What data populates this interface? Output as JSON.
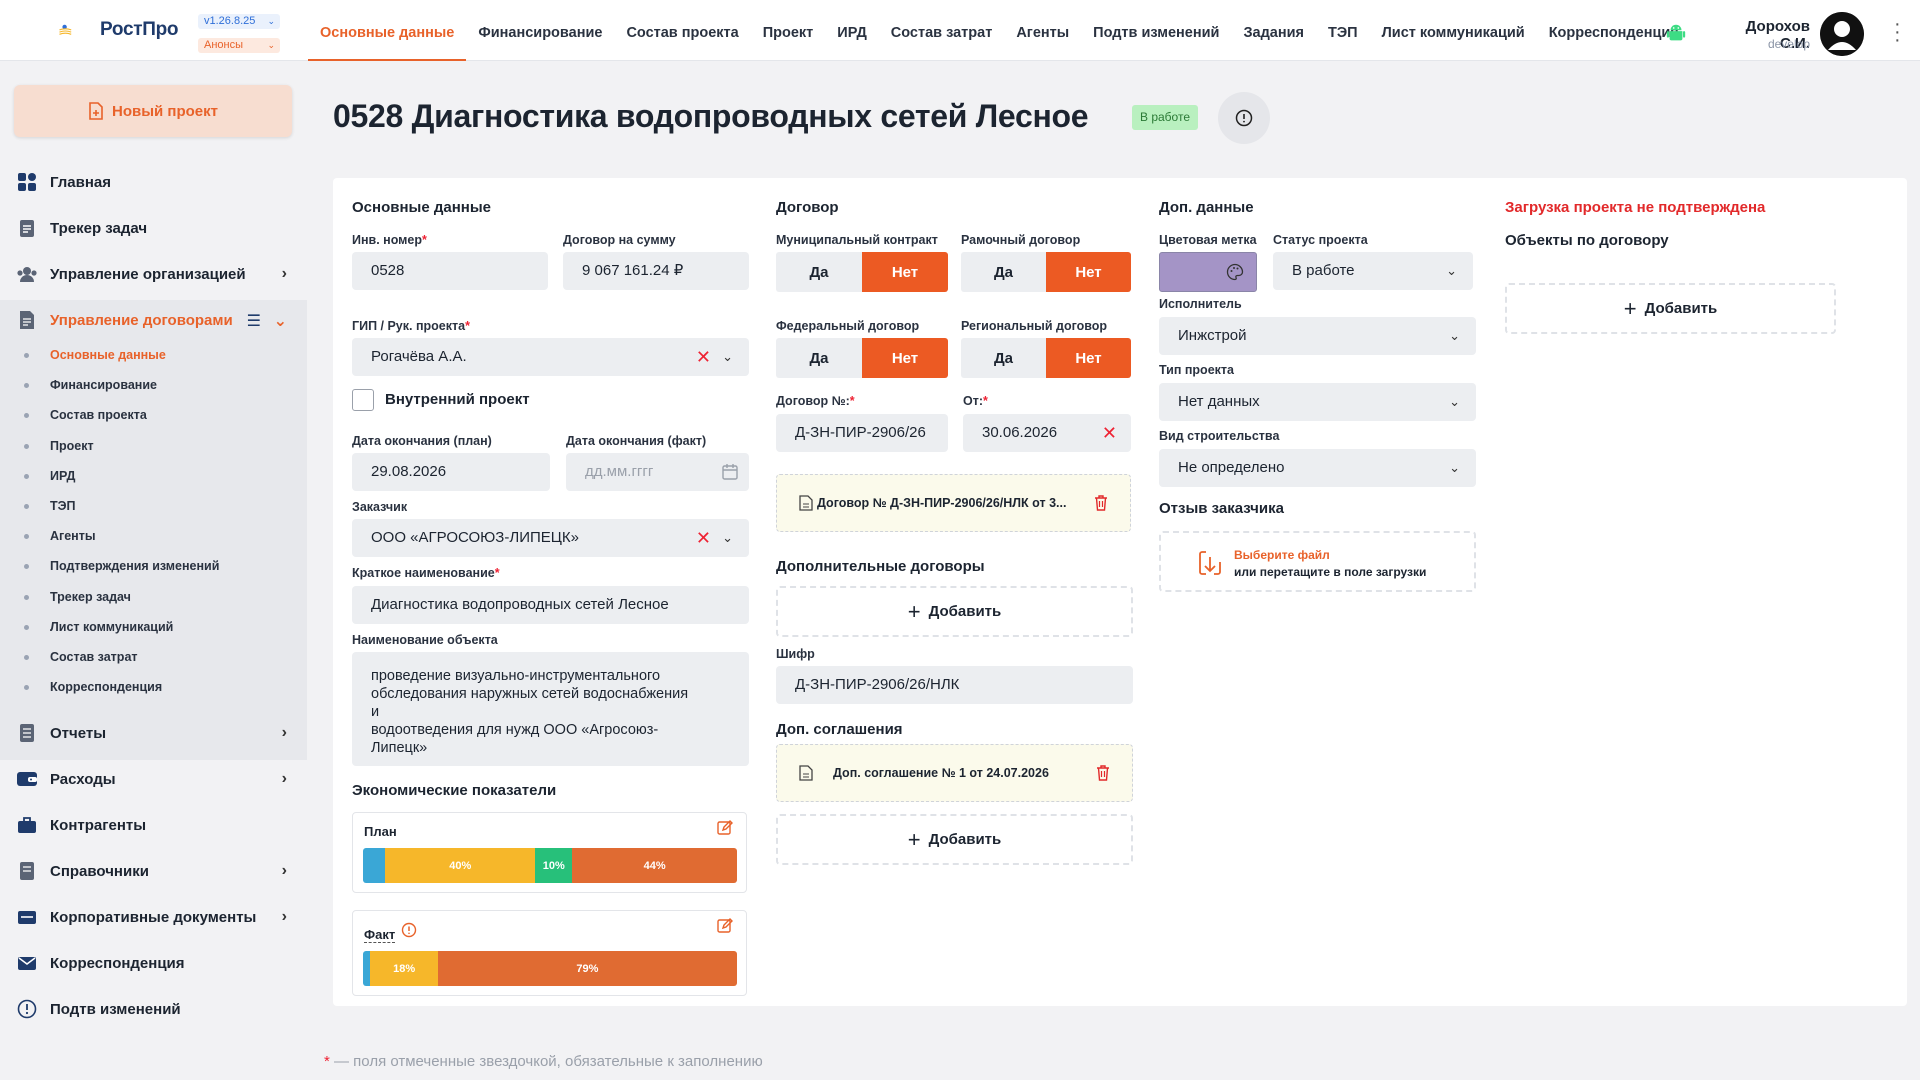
{
  "app": {
    "logo_text": "РостПро",
    "version": "v1.26.8.25",
    "announcements": "Анонсы"
  },
  "nav": {
    "items": [
      "Основные данные",
      "Финансирование",
      "Состав проекта",
      "Проект",
      "ИРД",
      "Состав затрат",
      "Агенты",
      "Подтв изменений",
      "Задания",
      "ТЭП",
      "Лист коммуникаций",
      "Корреспонденция"
    ],
    "active_index": 0
  },
  "user": {
    "name": "Дорохов С.И.",
    "role": "develop"
  },
  "sidebar": {
    "new_project": "Новый проект",
    "items": [
      {
        "label": "Главная",
        "icon": "grid-icon"
      },
      {
        "label": "Трекер задач",
        "icon": "clipboard-icon"
      },
      {
        "label": "Управление организацией",
        "icon": "users-icon"
      },
      {
        "label": "Управление договорами",
        "icon": "document-icon"
      },
      {
        "label": "Отчеты",
        "icon": "report-icon"
      },
      {
        "label": "Расходы",
        "icon": "wallet-icon"
      },
      {
        "label": "Контрагенты",
        "icon": "briefcase-icon"
      },
      {
        "label": "Справочники",
        "icon": "book-icon"
      },
      {
        "label": "Корпоративные документы",
        "icon": "folder-icon"
      },
      {
        "label": "Корреспонденция",
        "icon": "mail-icon"
      },
      {
        "label": "Подтв изменений",
        "icon": "alert-icon"
      }
    ],
    "subitems": [
      "Основные данные",
      "Финансирование",
      "Состав проекта",
      "Проект",
      "ИРД",
      "ТЭП",
      "Агенты",
      "Подтверждения изменений",
      "Трекер задач",
      "Лист коммуникаций",
      "Состав затрат",
      "Корреспонденция"
    ]
  },
  "page": {
    "title": "0528 Диагностика водопроводных сетей Лесное",
    "status_badge": "В работе"
  },
  "main": {
    "title": "Основные данные",
    "inv_label": "Инв. номер",
    "inv_value": "0528",
    "contract_sum_label": "Договор на сумму",
    "contract_sum_value": "9 067 161.24 ₽",
    "gip_label": "ГИП / Рук. проекта",
    "gip_value": "Рогачёва А.А.",
    "internal_label": "Внутренний проект",
    "end_plan_label": "Дата окончания (план)",
    "end_plan_value": "29.08.2026",
    "end_fact_label": "Дата окончания (факт)",
    "end_fact_placeholder": "дд.мм.гггг",
    "customer_label": "Заказчик",
    "customer_value": "ООО «АГРОСОЮЗ-ЛИПЕЦК»",
    "short_name_label": "Краткое наименование",
    "short_name_value": "Диагностика водопроводных сетей Лесное",
    "object_name_label": "Наименование объекта",
    "object_name_value": "проведение визуально-инструментального\nобследования наружных сетей водоснабжения\nи\nводоотведения для нужд ООО «Агросоюз-\nЛипецк»",
    "econ_title": "Экономические показатели",
    "plan_label": "План",
    "plan_segments": [
      {
        "pct": 6,
        "label": "",
        "color": "#3aa7d6"
      },
      {
        "pct": 40,
        "label": "40%",
        "color": "#f6b72a"
      },
      {
        "pct": 10,
        "label": "10%",
        "color": "#27c07a"
      },
      {
        "pct": 44,
        "label": "44%",
        "color": "#e06b32"
      }
    ],
    "fact_label": "Факт",
    "fact_segments": [
      {
        "pct": 2,
        "label": "",
        "color": "#3aa7d6"
      },
      {
        "pct": 18,
        "label": "18%",
        "color": "#f6b72a"
      },
      {
        "pct": 80,
        "label": "79%",
        "color": "#e06b32"
      }
    ]
  },
  "contract": {
    "title": "Договор",
    "municipal_label": "Муниципальный контракт",
    "frame_label": "Рамочный договор",
    "federal_label": "Федеральный договор",
    "regional_label": "Региональный договор",
    "yes": "Да",
    "no": "Нет",
    "number_label": "Договор №:",
    "number_value": "Д-ЗН-ПИР-2906/26",
    "from_label": "От:",
    "from_value": "30.06.2026",
    "doc_file": "Договор № Д-ЗН-ПИР-2906/26/НЛК от 3...",
    "extra_title": "Дополнительные договоры",
    "add_label": "Добавить",
    "cipher_label": "Шифр",
    "cipher_value": "Д-ЗН-ПИР-2906/26/НЛК",
    "agreements_title": "Доп. соглашения",
    "agreement_file": "Доп. соглашение № 1 от 24.07.2026"
  },
  "extra": {
    "title": "Доп. данные",
    "color_label": "Цветовая метка",
    "color_value": "#a494c6",
    "status_label": "Статус проекта",
    "status_value": "В работе",
    "executor_label": "Исполнитель",
    "executor_value": "Инжстрой",
    "type_label": "Тип проекта",
    "type_value": "Нет данных",
    "construction_label": "Вид строительства",
    "construction_value": "Не определено",
    "feedback_title": "Отзыв заказчика",
    "upload_line1": "Выберите файл",
    "upload_line2": "или перетащите в поле загрузки"
  },
  "right": {
    "warning": "Загрузка проекта не подтверждена",
    "objects_title": "Объекты по договору",
    "add_label": "Добавить"
  },
  "footer": {
    "star": "*",
    "note": " — поля отмеченные звездочкой, обязательные к заполнению"
  }
}
